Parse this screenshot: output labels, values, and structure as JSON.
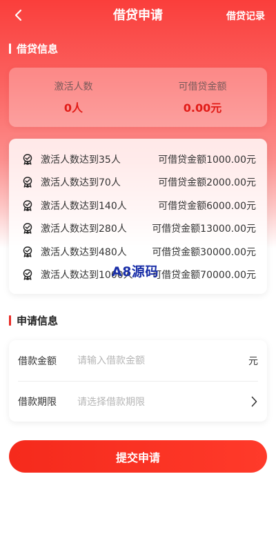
{
  "header": {
    "title": "借贷申请",
    "record_link": "借贷记录"
  },
  "loan_info": {
    "section_title": "借贷信息",
    "stats": [
      {
        "label": "激活人数",
        "value": "0人"
      },
      {
        "label": "可借贷金额",
        "value": "0.00元"
      }
    ],
    "tiers": [
      {
        "condition": "激活人数达到35人",
        "amount": "可借贷金额1000.00元"
      },
      {
        "condition": "激活人数达到70人",
        "amount": "可借贷金额2000.00元"
      },
      {
        "condition": "激活人数达到140人",
        "amount": "可借贷金额6000.00元"
      },
      {
        "condition": "激活人数达到280人",
        "amount": "可借贷金额13000.00元"
      },
      {
        "condition": "激活人数达到480人",
        "amount": "可借贷金额30000.00元"
      },
      {
        "condition": "激活人数达到1000人",
        "amount": "可借贷金额70000.00元"
      }
    ],
    "tier_icon": "medal-icon"
  },
  "watermark": "A8源码",
  "apply_info": {
    "section_title": "申请信息",
    "amount": {
      "label": "借款金额",
      "placeholder": "请输入借款金额",
      "unit": "元",
      "value": ""
    },
    "period": {
      "label": "借款期限",
      "placeholder": "请选择借款期限"
    }
  },
  "submit": {
    "label": "提交申请"
  },
  "colors": {
    "accent_red": "#e82a25",
    "value_red": "#e21c18",
    "button_red": "#f52a1c",
    "watermark_blue": "#1a2fa8"
  }
}
